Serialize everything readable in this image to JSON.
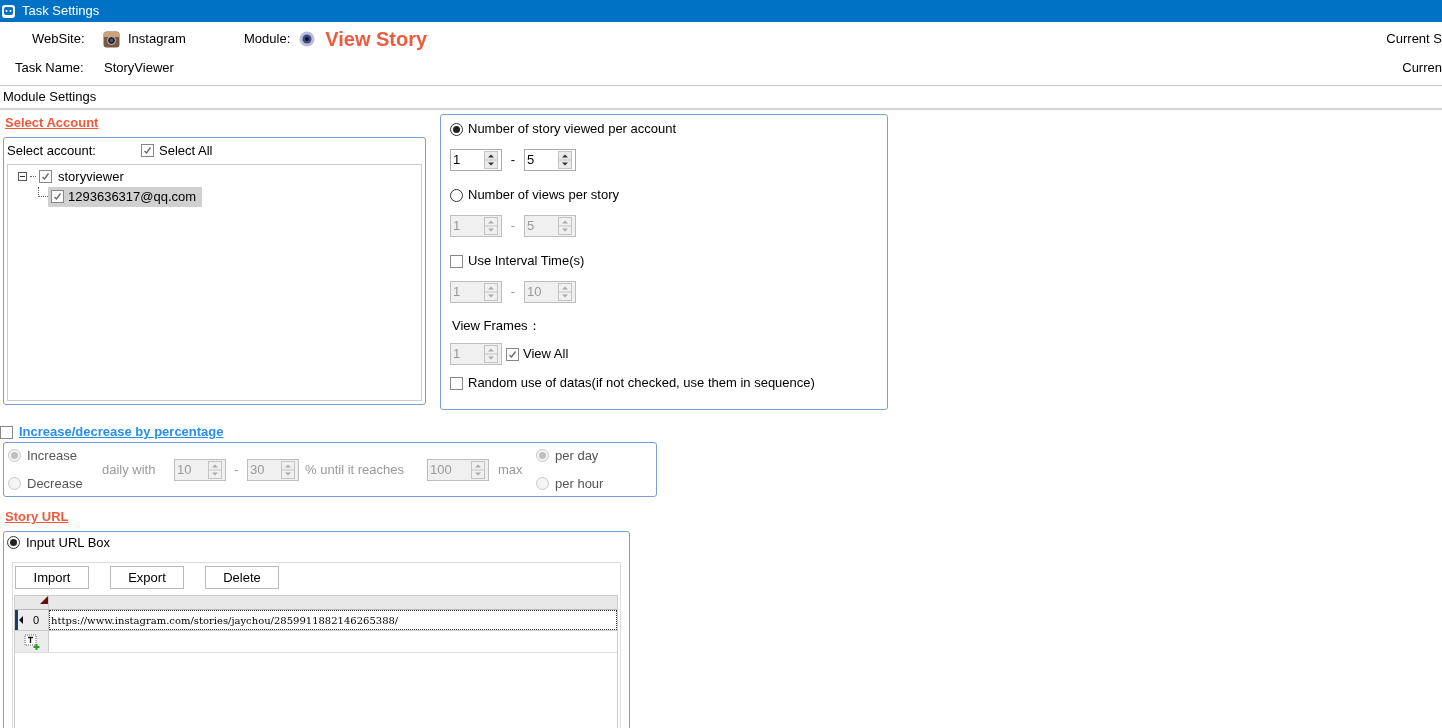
{
  "window": {
    "title": "Task Settings"
  },
  "header": {
    "website_label": "WebSite:",
    "website": "Instagram",
    "module_label": "Module:",
    "module": "View Story",
    "task_name_label": "Task Name:",
    "task_name": "StoryViewer",
    "right_top": "Current S",
    "right_bottom": "Curren"
  },
  "section_tab": "Module Settings",
  "select_account": {
    "heading": "Select Account",
    "label": "Select account:",
    "select_all": {
      "label": "Select All",
      "checked": true
    },
    "tree": [
      {
        "label": "storyviewer",
        "checked": true,
        "expanded": true,
        "selected": false,
        "children": [
          {
            "label": "1293636317@qq.com",
            "checked": true,
            "selected": true
          }
        ]
      }
    ]
  },
  "options": [
    {
      "kind": "radio",
      "label": "Number of story viewed per account",
      "selected": true
    },
    {
      "kind": "range",
      "disabled": false,
      "from": "1",
      "separator": "-",
      "to": "5"
    },
    {
      "kind": "radio",
      "label": "Number of views per story",
      "selected": false
    },
    {
      "kind": "range",
      "disabled": true,
      "from": "1",
      "separator": "-",
      "to": "5"
    },
    {
      "kind": "checkbox",
      "label": "Use Interval Time(s)",
      "checked": false
    },
    {
      "kind": "range",
      "disabled": true,
      "from": "1",
      "separator": "-",
      "to": "10"
    },
    {
      "kind": "frames",
      "label": "View Frames：",
      "disabled": true,
      "value": "1",
      "view_all": {
        "label": "View All",
        "checked": true
      }
    },
    {
      "kind": "checkbox",
      "label": "Random use of datas(if not checked, use them in sequence)",
      "checked": false
    }
  ],
  "percentage": {
    "label": "Increase/decrease by percentage",
    "checked": false,
    "direction": [
      {
        "label": "Increase",
        "selected": true
      },
      {
        "label": "Decrease",
        "selected": false
      }
    ],
    "daily_with": "daily with",
    "from": "10",
    "separator": "-",
    "to": "30",
    "until": "% until it reaches",
    "limit": "100",
    "max": "max",
    "period": [
      {
        "label": "per day",
        "selected": true
      },
      {
        "label": "per hour",
        "selected": false
      }
    ]
  },
  "story_url": {
    "heading": "Story URL",
    "source": {
      "label": "Input URL Box",
      "selected": true
    },
    "buttons": [
      "Import",
      "Export",
      "Delete"
    ],
    "rows": [
      {
        "index": "0",
        "url": "https://www.instagram.com/stories/jaychou/2859911882146265388/",
        "selected": true
      }
    ]
  }
}
